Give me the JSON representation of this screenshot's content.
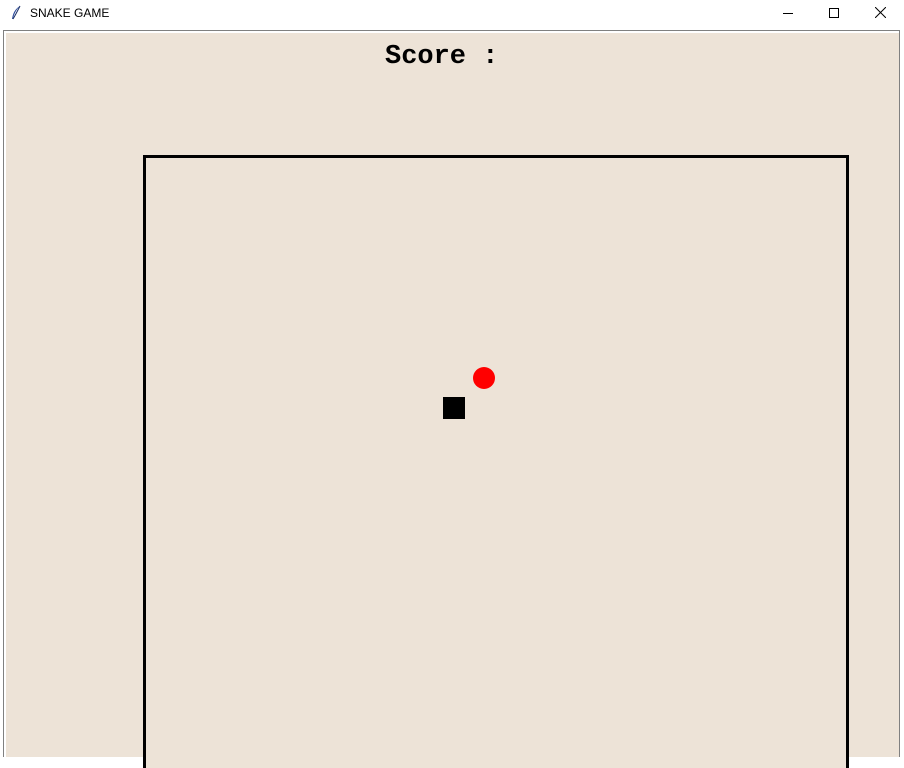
{
  "window": {
    "title": "SNAKE GAME",
    "icon": "feather-icon",
    "controls": [
      "minimize-icon",
      "maximize-icon",
      "close-icon"
    ]
  },
  "game": {
    "score_label": "Score :",
    "board_background": "#ede3d7",
    "food_color": "#ff0000",
    "snake_color": "#000000"
  }
}
